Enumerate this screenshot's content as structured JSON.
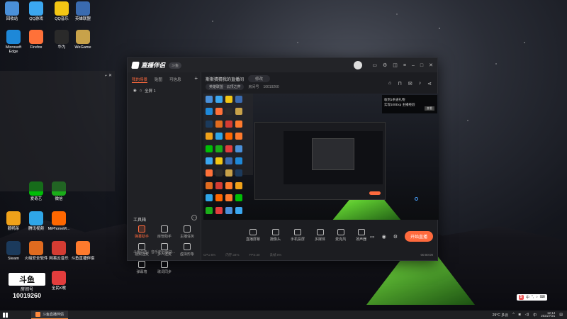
{
  "desktop": {
    "icons": [
      {
        "label": "回收站",
        "color": "#4a90d9"
      },
      {
        "label": "QQ游戏",
        "color": "#3ba7f0"
      },
      {
        "label": "QQ音乐",
        "color": "#f3c614"
      },
      {
        "label": "英雄联盟",
        "color": "#3a6bb0"
      },
      {
        "label": "Microsoft Edge",
        "color": "#1e88d8"
      },
      {
        "label": "Firefox",
        "color": "#ff7139"
      },
      {
        "label": "华为",
        "color": "#2a2a2a"
      },
      {
        "label": "WeGame",
        "color": "#c8a24a"
      },
      {
        "label": "Steam",
        "color": "#1b3a5c"
      },
      {
        "label": "火绒安全软件",
        "color": "#e06b1f"
      },
      {
        "label": "网易云音乐",
        "color": "#d43c33"
      },
      {
        "label": "斗鱼直播伴侣",
        "color": "#ff7a2d"
      },
      {
        "label": "鹅鸭杀",
        "color": "#f0a21a"
      },
      {
        "label": "腾讯视频",
        "color": "#2fa6e8"
      },
      {
        "label": "MiPhoneM...",
        "color": "#ff6700"
      },
      {
        "label": "斗鱼直播",
        "color": "#ff7a2d"
      },
      {
        "label": "爱奇艺",
        "color": "#00be06"
      },
      {
        "label": "微信",
        "color": "#1aad19"
      },
      {
        "label": "全民K歌",
        "color": "#e33d3d"
      }
    ]
  },
  "app": {
    "brand": "直播伴侣",
    "version_tag": "斗鱼",
    "tabs": [
      "我的场景",
      "贴图",
      "可信息"
    ],
    "scene_name": "全屏 1",
    "tool_section_title": "工具箱",
    "tools": [
      {
        "label": "弹幕助手",
        "hot": true
      },
      {
        "label": "房管助手",
        "hot": false
      },
      {
        "label": "主播任务",
        "hot": false
      },
      {
        "label": "视频连麦",
        "hot": false
      },
      {
        "label": "多人连麦",
        "hot": false
      },
      {
        "label": "虚拟形象",
        "hot": false
      },
      {
        "label": "弹幕墙",
        "hot": false
      },
      {
        "label": "歌词同步",
        "hot": false
      }
    ],
    "announcement": "斗鱼公告：音乐电台版块..."
  },
  "room": {
    "title": "斯斯猜猜我的直播间",
    "title_pill": "修改",
    "category": "英雄联盟 · 云顶之弈",
    "room_id_label": "房间号",
    "room_id": "10019260"
  },
  "preview": {
    "banner_line1": "收到1条道礼物",
    "banner_line2": "实现100Exp 主播经验",
    "banner_btn": "查看"
  },
  "bottom_tools": [
    "直播屏幕",
    "摄像头",
    "手机投屏",
    "多媒体",
    "麦克风",
    "扬声器"
  ],
  "go_live": "开始直播",
  "status": {
    "items": [
      "CPU:6%",
      "内存:34%",
      "FPS:30",
      "丢帧:0%"
    ],
    "time": "00:00:00"
  },
  "watermark": {
    "logo": "斗鱼",
    "room_label": "房间号",
    "room_id": "10019260"
  },
  "taskbar": {
    "app_label": "斗鱼直播伴侣",
    "weather": "29°C 多云",
    "ime": "中",
    "time": "12:14",
    "date": "2021/7/21"
  }
}
